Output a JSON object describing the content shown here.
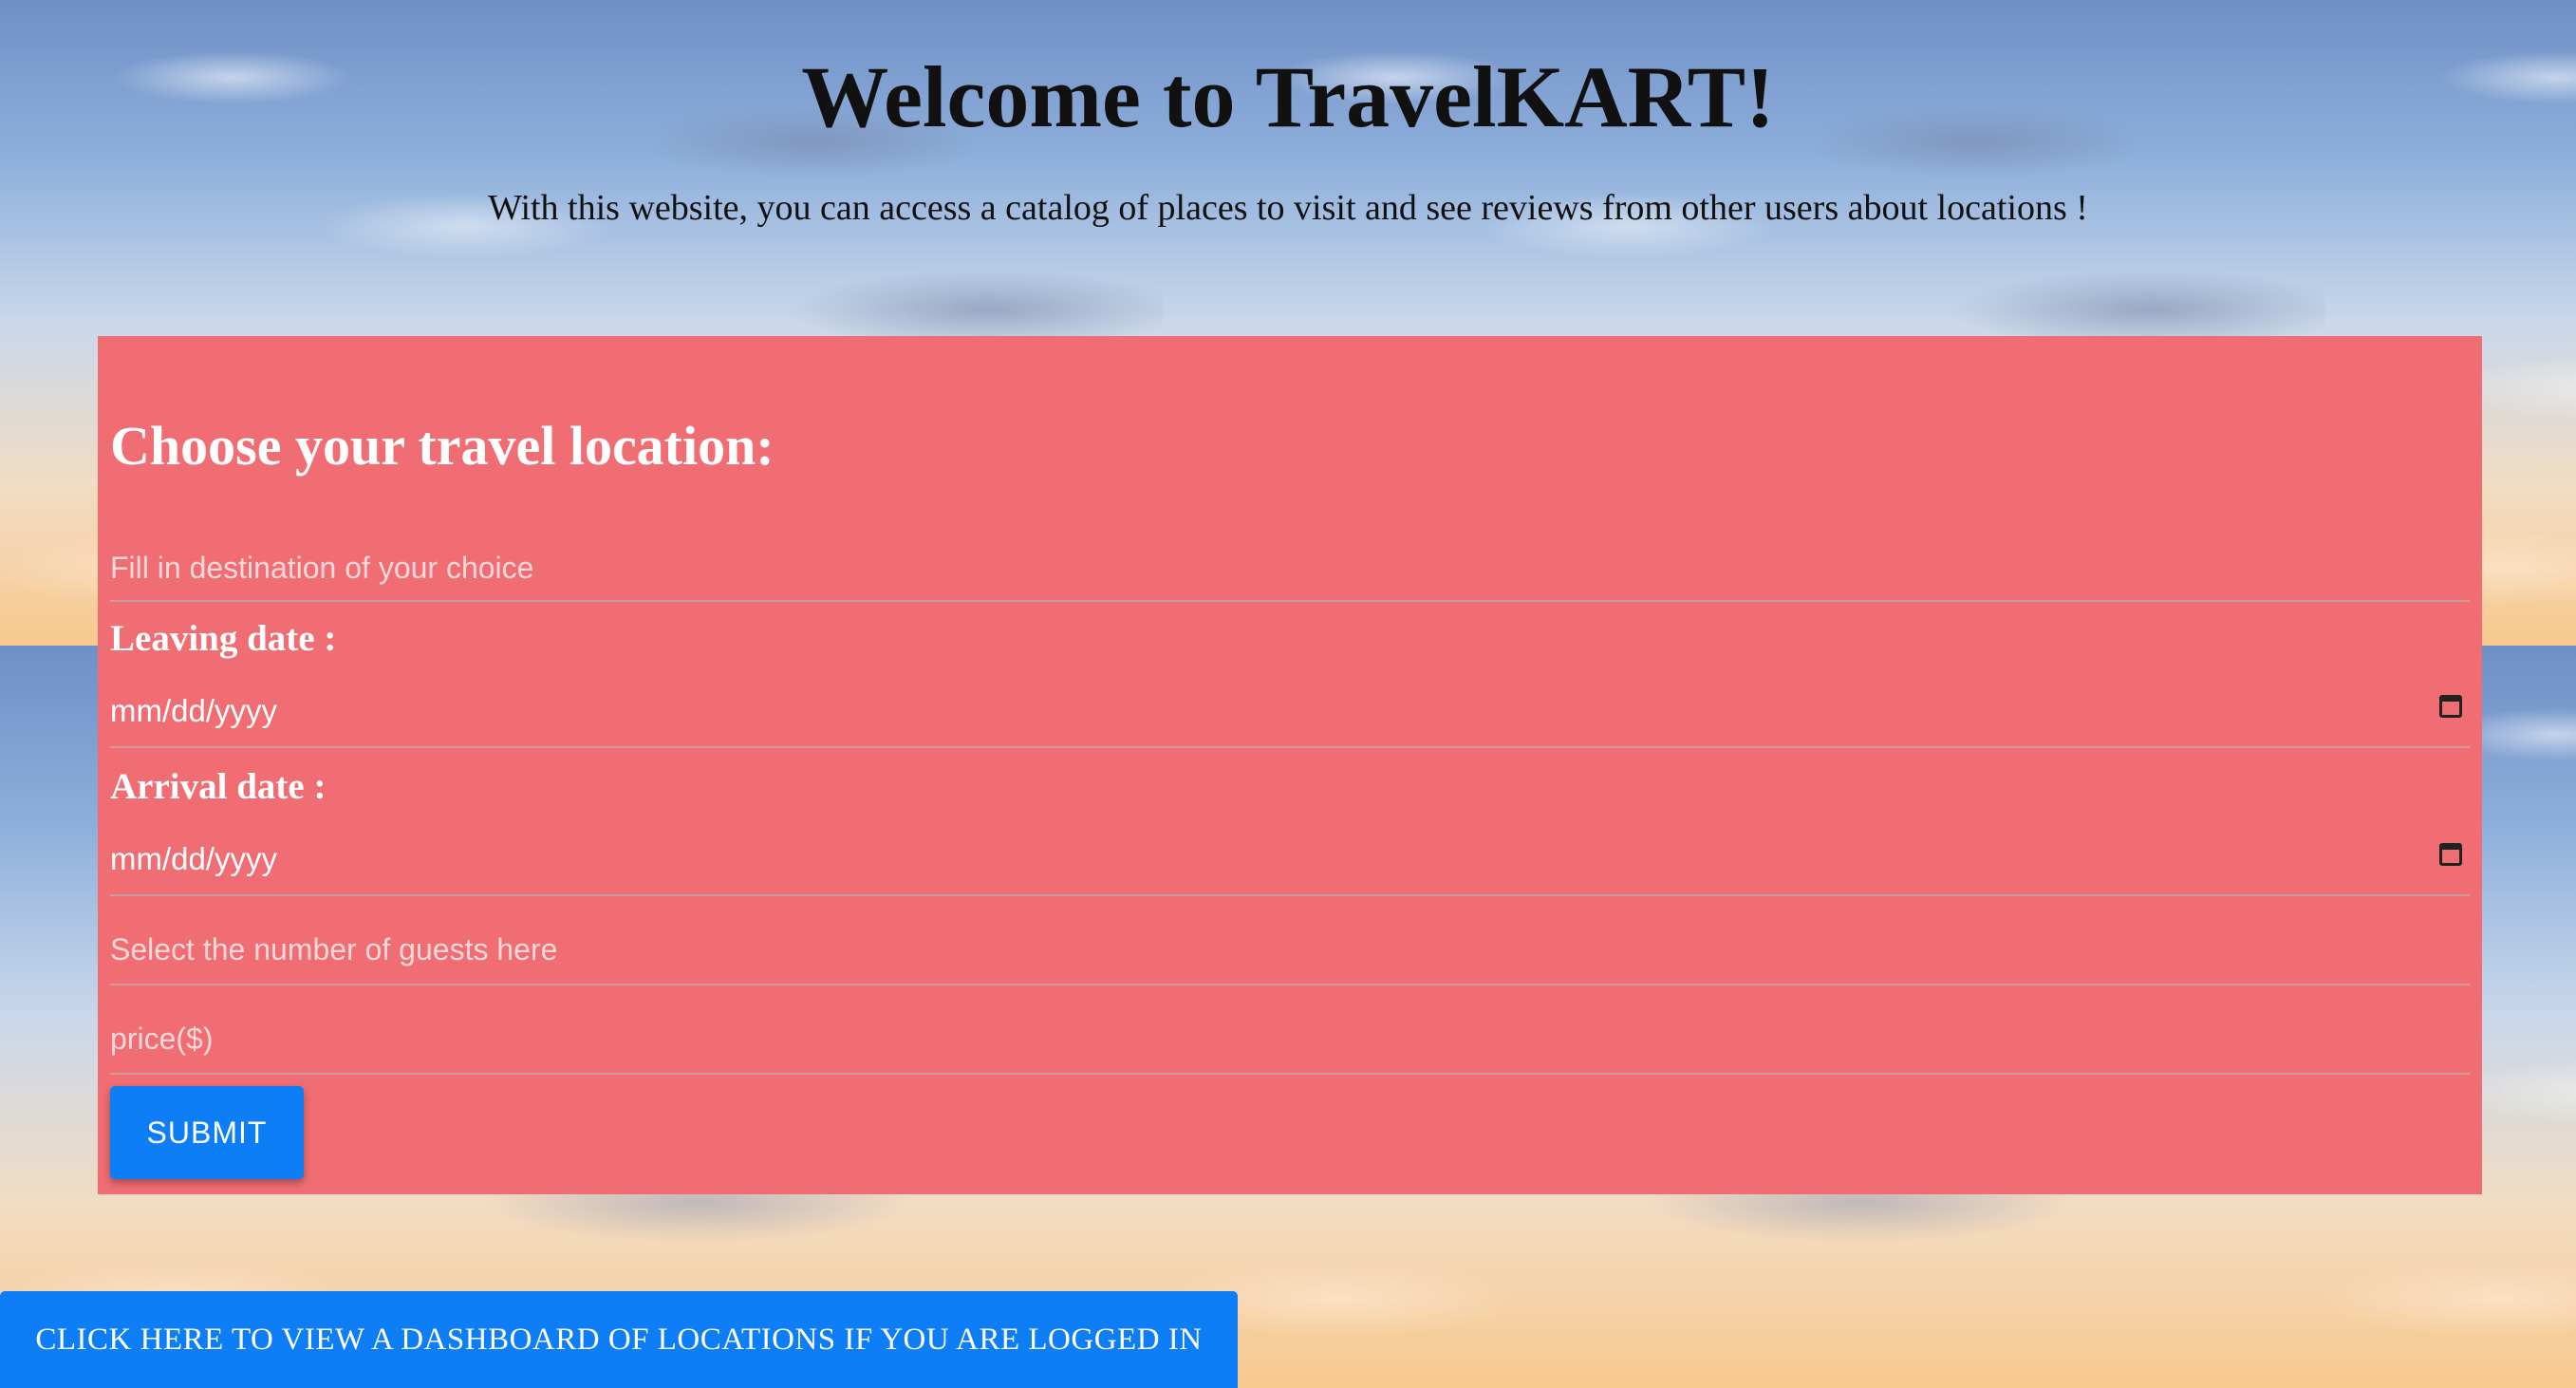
{
  "header": {
    "title": "Welcome to TravelKART!",
    "subtitle": "With this website, you can access a catalog of places to visit and see reviews from other users about locations !"
  },
  "form": {
    "heading": "Choose your travel location:",
    "destination": {
      "placeholder": "Fill in destination of your choice",
      "value": ""
    },
    "leaving": {
      "label": "Leaving date :",
      "value": "mm/dd/yyyy",
      "icon": "calendar-icon"
    },
    "arrival": {
      "label": "Arrival date :",
      "value": "mm/dd/yyyy",
      "icon": "calendar-icon"
    },
    "guests": {
      "placeholder": "Select the number of guests here",
      "value": ""
    },
    "price": {
      "placeholder": "price($)",
      "value": ""
    },
    "submit_label": "SUBMIT"
  },
  "dashboard_link_label": "CLICK HERE TO VIEW A DASHBOARD OF LOCATIONS IF YOU ARE LOGGED IN",
  "colors": {
    "form_background": "#ef6d73",
    "button_blue": "#0d7ef5"
  }
}
